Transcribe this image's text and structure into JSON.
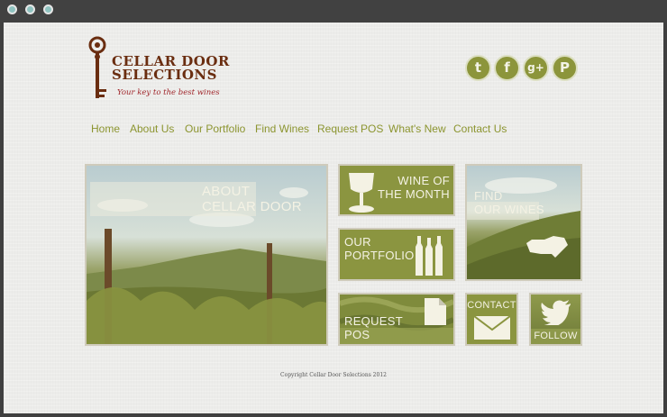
{
  "brand": {
    "title_line1": "CELLAR DOOR",
    "title_line2": "SELECTIONS",
    "tagline": "Your key to the best wines"
  },
  "social": [
    {
      "name": "twitter-icon",
      "glyph": "t"
    },
    {
      "name": "facebook-icon",
      "glyph": "f"
    },
    {
      "name": "google-plus-icon",
      "glyph": "g+"
    },
    {
      "name": "pinterest-icon",
      "glyph": "P"
    }
  ],
  "nav": {
    "items": [
      "Home",
      "About Us",
      "Our Portfolio",
      "Find Wines",
      "Request POS",
      "What's New",
      "Contact Us"
    ]
  },
  "tiles": {
    "about_line1": "ABOUT",
    "about_line2": "CELLAR DOOR",
    "wine_month_line1": "WINE OF",
    "wine_month_line2": "THE MONTH",
    "find_line1": "FIND",
    "find_line2": "OUR WINES",
    "portfolio_line1": "OUR",
    "portfolio_line2": "PORTFOLIO",
    "request_line1": "REQUEST",
    "request_line2": "POS",
    "contact": "CONTACT",
    "follow": "FOLLOW"
  },
  "footer": {
    "copyright": "Copyright Cellar Door Selections 2012"
  },
  "colors": {
    "accent_olive": "#8b9540",
    "nav_text": "#8c9530",
    "logo_brown": "#6a2d10",
    "tagline_red": "#a0252a"
  }
}
